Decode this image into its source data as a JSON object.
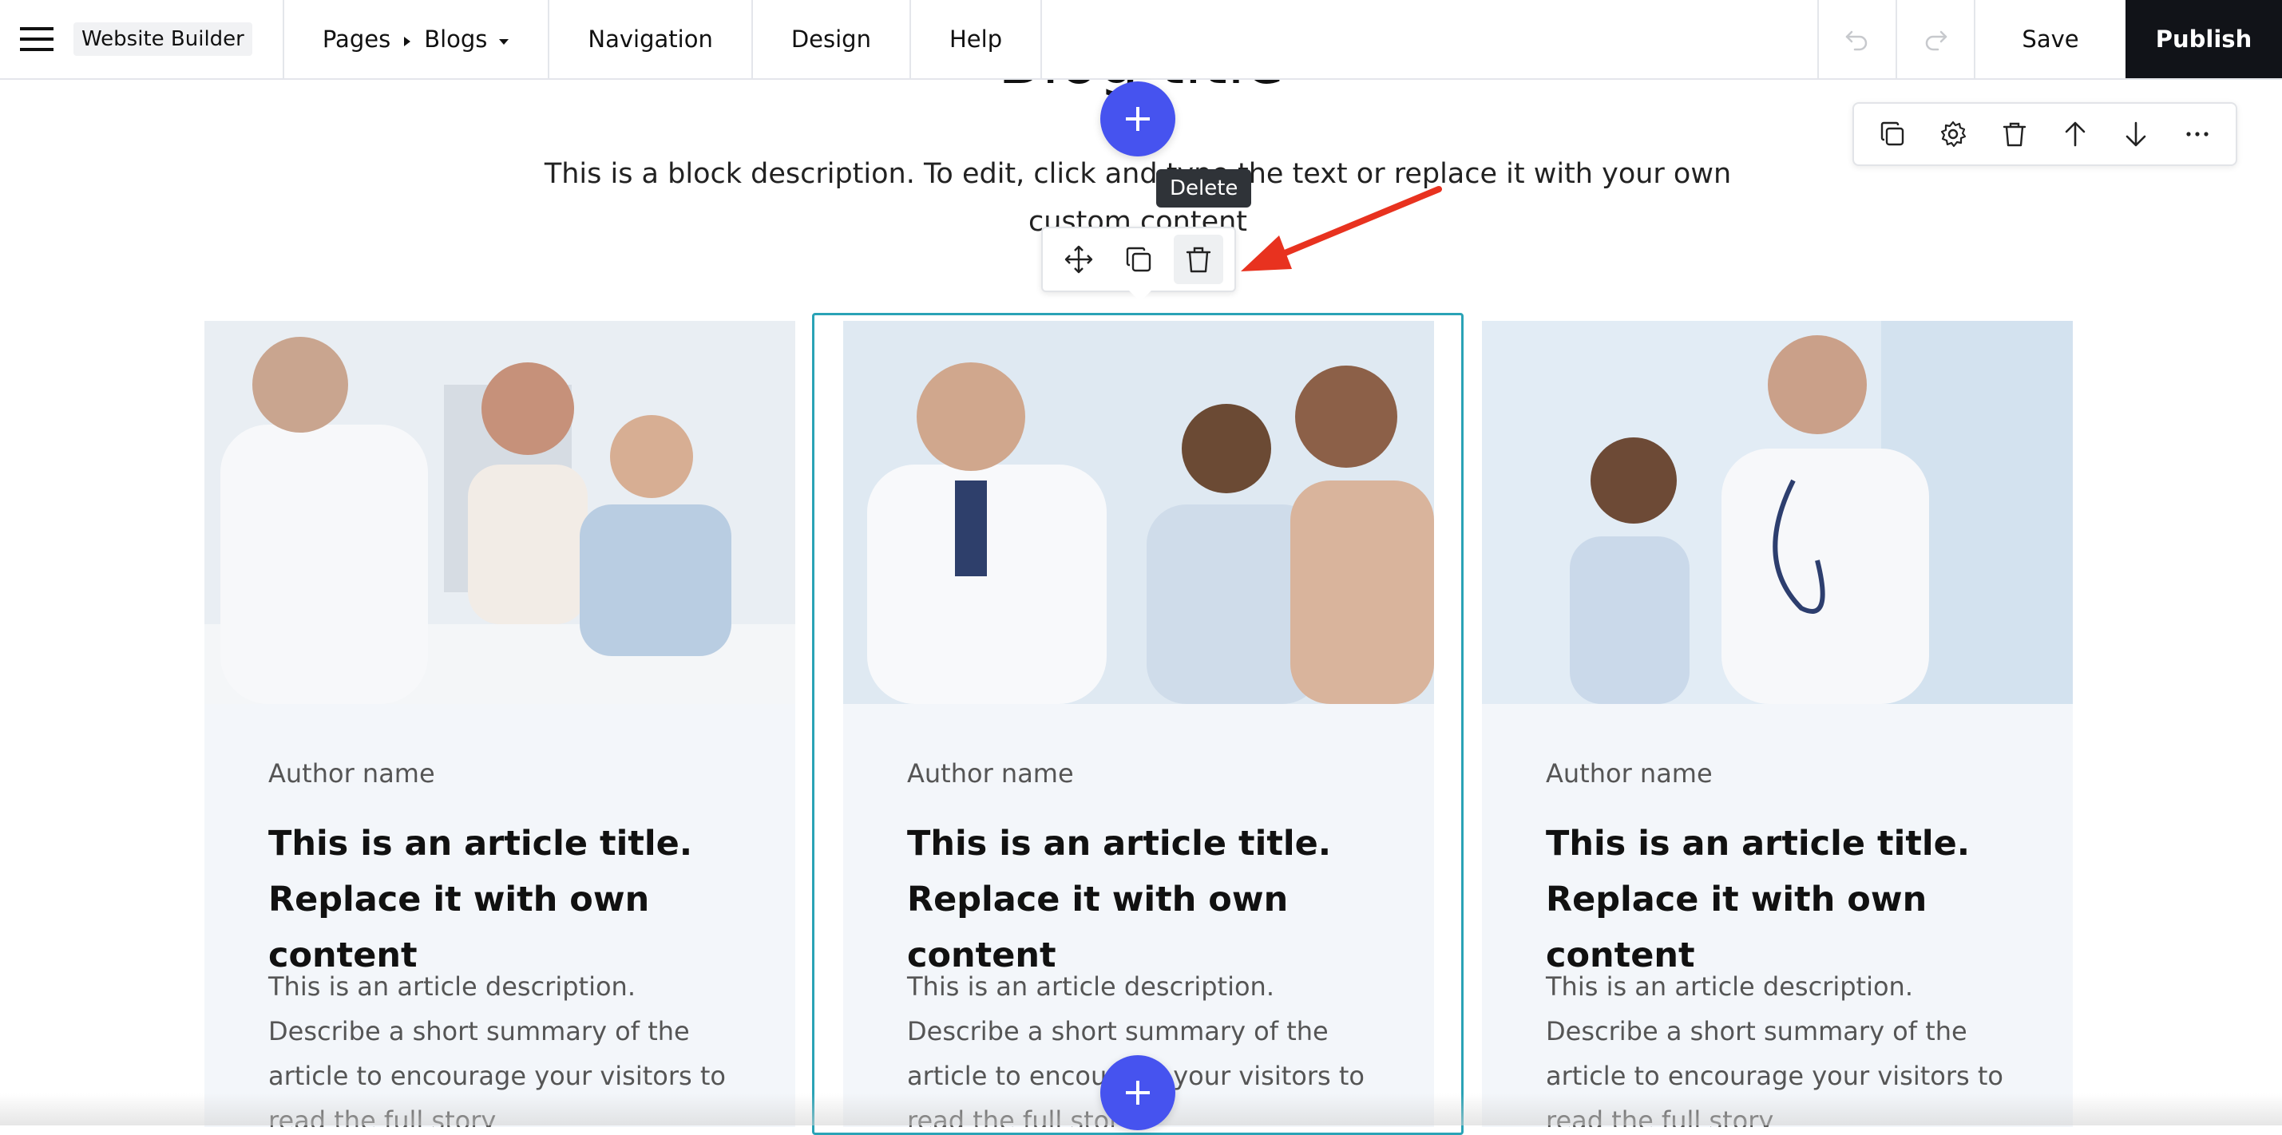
{
  "app": {
    "brand": "Website Builder"
  },
  "topbar": {
    "pages_label": "Pages",
    "current_page": "Blogs",
    "navigation_label": "Navigation",
    "design_label": "Design",
    "help_label": "Help",
    "save_label": "Save",
    "publish_label": "Publish"
  },
  "block": {
    "title": "Blog title",
    "description": "This is a block description. To edit, click and type the text or replace it with your own custom content"
  },
  "tooltip": {
    "delete": "Delete"
  },
  "block_toolbar": {
    "icons": [
      "duplicate-icon",
      "gear-icon",
      "trash-icon",
      "arrow-up-icon",
      "arrow-down-icon",
      "more-icon"
    ]
  },
  "element_toolbar": {
    "icons": [
      "move-icon",
      "duplicate-icon",
      "trash-icon"
    ]
  },
  "cards": [
    {
      "author": "Author name",
      "title": "This is an article title. Replace it with own content",
      "description": "This is an article description. Describe a short summary of the article to encourage your visitors to read the full story"
    },
    {
      "author": "Author name",
      "title": "This is an article title. Replace it with own content",
      "description": "This is an article description. Describe a short summary of the article to encourage your visitors to read the full story"
    },
    {
      "author": "Author name",
      "title": "This is an article title. Replace it with own content",
      "description": "This is an article description. Describe a short summary of the article to encourage your visitors to read the full story"
    }
  ],
  "colors": {
    "accent": "#4653ef",
    "selection": "#2aa3b6",
    "publish_bg": "#111318",
    "card_bg": "#f3f6fa",
    "annotation_arrow": "#e8321f"
  }
}
